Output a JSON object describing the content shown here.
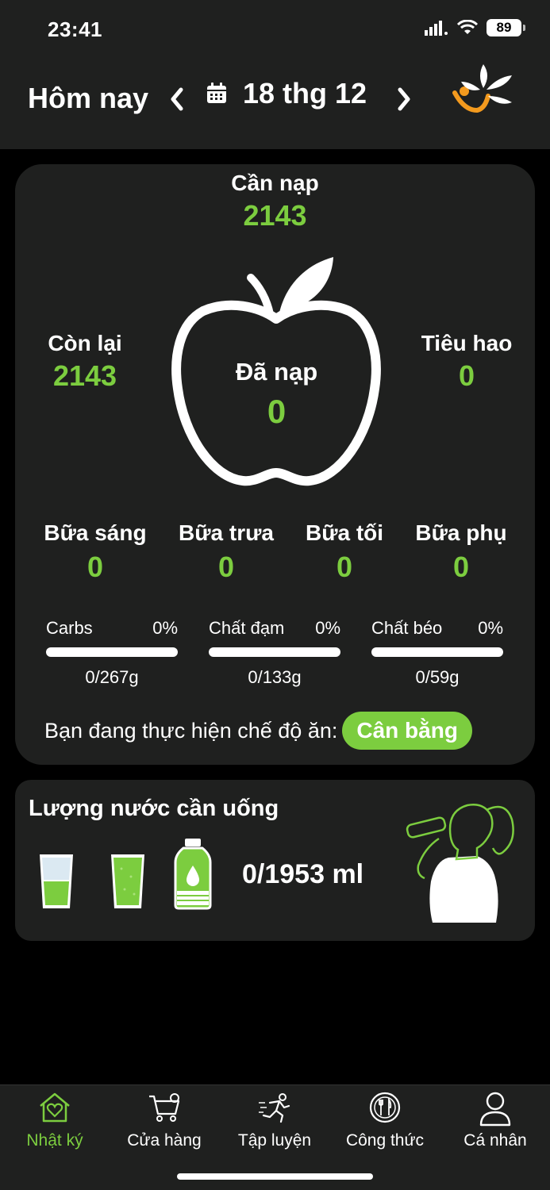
{
  "status": {
    "time": "23:41",
    "battery": "89"
  },
  "header": {
    "title": "Hôm nay",
    "date": "18 thg 12"
  },
  "summary": {
    "need_label": "Cần nạp",
    "need_value": "2143",
    "remaining_label": "Còn lại",
    "remaining_value": "2143",
    "burned_label": "Tiêu hao",
    "burned_value": "0",
    "consumed_label": "Đã nạp",
    "consumed_value": "0"
  },
  "meals": [
    {
      "label": "Bữa sáng",
      "value": "0"
    },
    {
      "label": "Bữa trưa",
      "value": "0"
    },
    {
      "label": "Bữa tối",
      "value": "0"
    },
    {
      "label": "Bữa phụ",
      "value": "0"
    }
  ],
  "macros": [
    {
      "label": "Carbs",
      "percent": "0%",
      "amount": "0/267g",
      "progress": 0
    },
    {
      "label": "Chất đạm",
      "percent": "0%",
      "amount": "0/133g",
      "progress": 0
    },
    {
      "label": "Chất béo",
      "percent": "0%",
      "amount": "0/59g",
      "progress": 0
    }
  ],
  "diet": {
    "label": "Bạn đang thực hiện chế độ ăn:",
    "value": "Cân bằng"
  },
  "water": {
    "title": "Lượng nước cần uống",
    "amount": "0/1953 ml"
  },
  "colors": {
    "accent": "#7ccd3f",
    "card": "#1f201f",
    "background": "#000000",
    "logo_orange": "#f39a1e"
  },
  "tabs": [
    {
      "label": "Nhật ký",
      "icon": "home-heart-icon",
      "active": true
    },
    {
      "label": "Cửa hàng",
      "icon": "cart-icon",
      "active": false
    },
    {
      "label": "Tập luyện",
      "icon": "runner-icon",
      "active": false
    },
    {
      "label": "Công thức",
      "icon": "plate-cutlery-icon",
      "active": false
    },
    {
      "label": "Cá nhân",
      "icon": "person-icon",
      "active": false
    }
  ]
}
